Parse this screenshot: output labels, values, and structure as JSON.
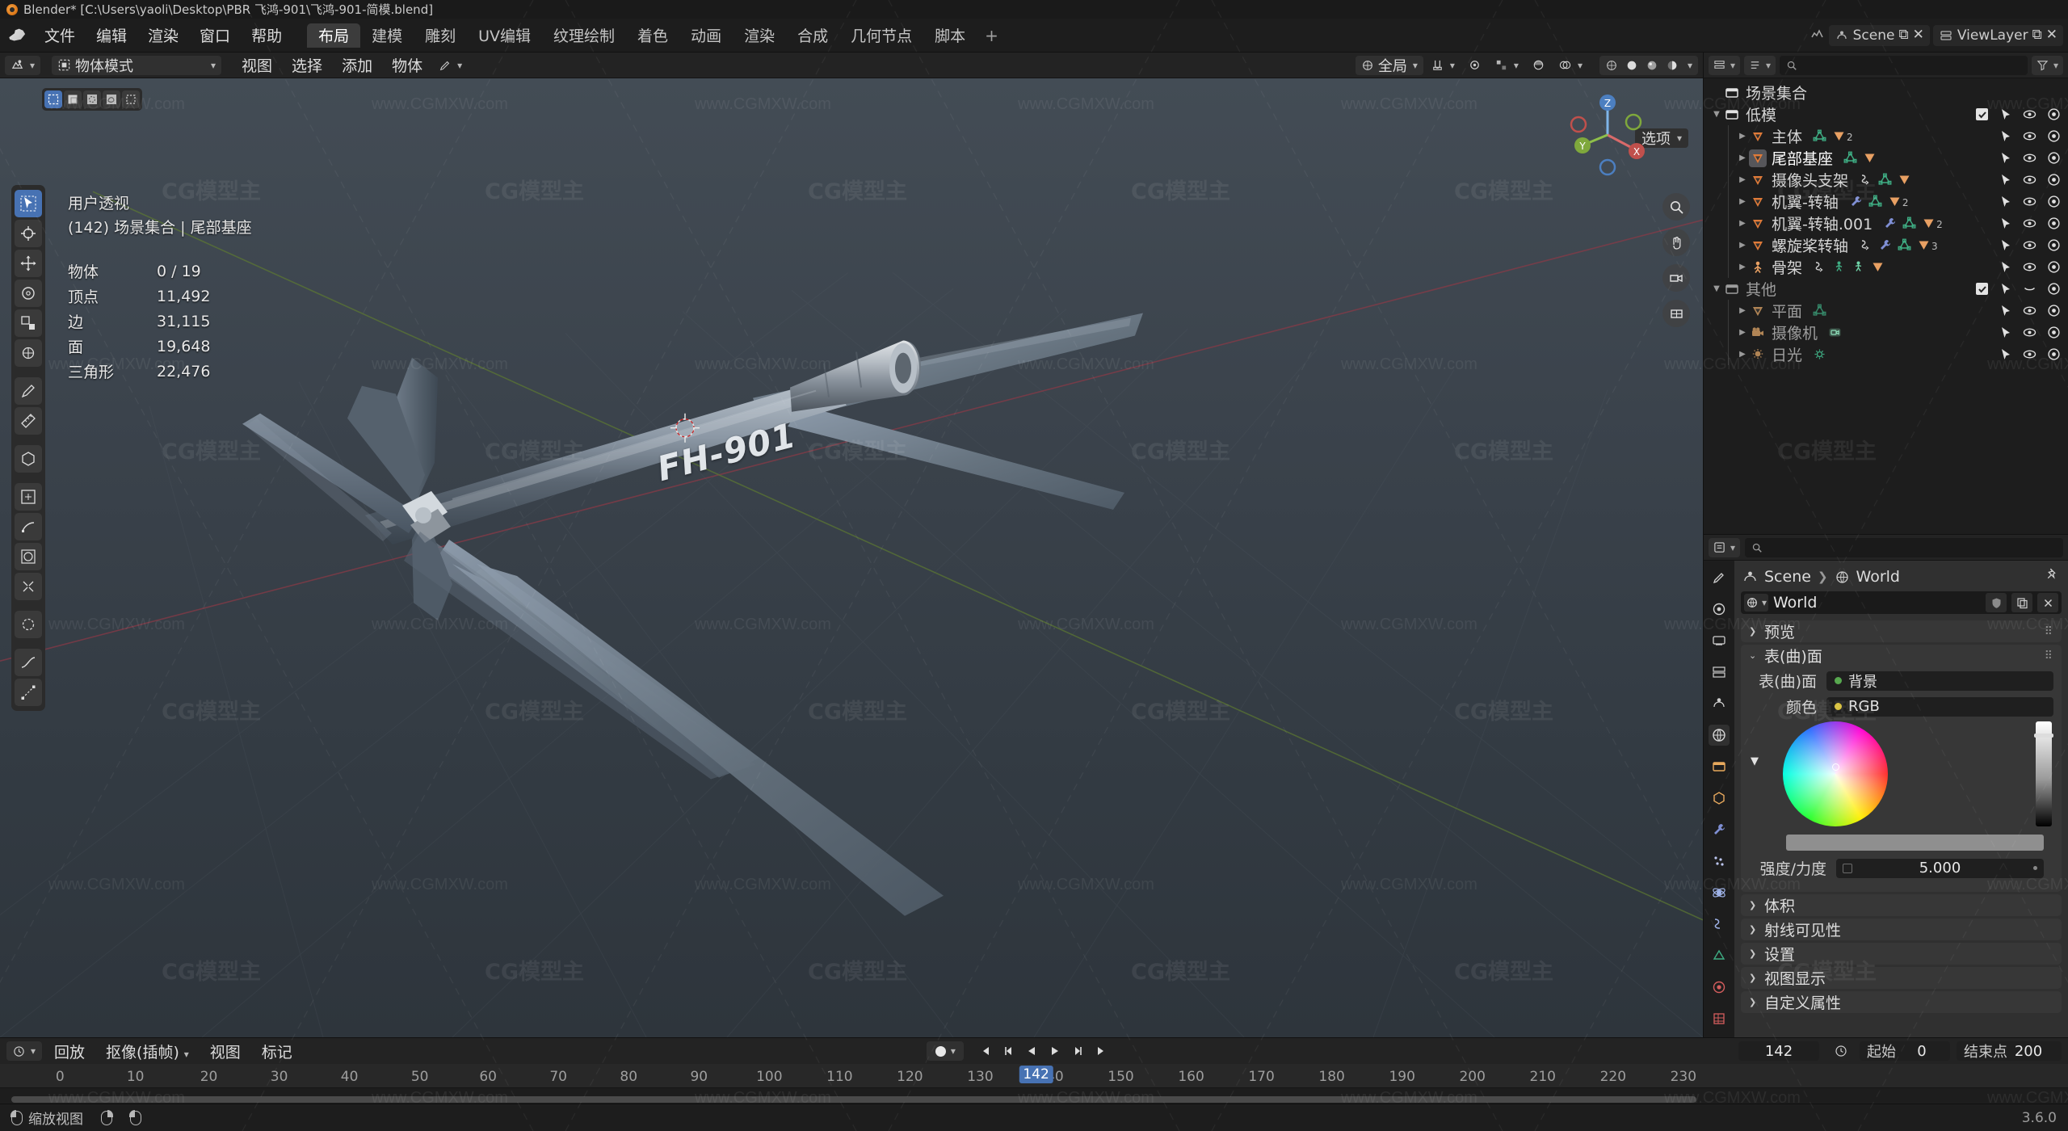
{
  "titlebar": {
    "text": "Blender* [C:\\Users\\yaoli\\Desktop\\PBR 飞鸿-901\\飞鸿-901-简模.blend]"
  },
  "topbar": {
    "menus": [
      "文件",
      "编辑",
      "渲染",
      "窗口",
      "帮助"
    ],
    "workspaces": [
      "布局",
      "建模",
      "雕刻",
      "UV编辑",
      "纹理绘制",
      "着色",
      "动画",
      "渲染",
      "合成",
      "几何节点",
      "脚本"
    ],
    "active_workspace": "布局",
    "add_tab": "+",
    "scene_name": "Scene",
    "viewlayer_name": "ViewLayer"
  },
  "viewport": {
    "header": {
      "mode": "物体模式",
      "menus": [
        "视图",
        "选择",
        "添加",
        "物体"
      ],
      "transform_orientation": "全局",
      "options_label": "选项"
    },
    "overlay": {
      "view_name": "用户透视",
      "collection_line": "(142) 场景集合 | 尾部基座",
      "stats": [
        {
          "label": "物体",
          "value": "0 / 19"
        },
        {
          "label": "顶点",
          "value": "11,492"
        },
        {
          "label": "边",
          "value": "31,115"
        },
        {
          "label": "面",
          "value": "19,648"
        },
        {
          "label": "三角形",
          "value": "22,476"
        }
      ]
    },
    "gizmo_axes": [
      "X",
      "Y",
      "Z"
    ],
    "model_text": "FH-901"
  },
  "outliner": {
    "header": {
      "search_placeholder": "",
      "filter_label": ""
    },
    "root": "场景集合",
    "items": [
      {
        "indent": 0,
        "type": "collection",
        "label": "低模",
        "expanded": true,
        "badges": [],
        "checkbox": true
      },
      {
        "indent": 1,
        "type": "mesh",
        "label": "主体",
        "badges": [
          "mesh-data",
          "material"
        ],
        "material_count": "2"
      },
      {
        "indent": 1,
        "type": "mesh",
        "label": "尾部基座",
        "selected": true,
        "badges": [
          "mesh-data",
          "material"
        ],
        "material_count": ""
      },
      {
        "indent": 1,
        "type": "mesh",
        "label": "摄像头支架",
        "badges": [
          "modifier-arrow",
          "mesh-data",
          "material"
        ],
        "material_count": ""
      },
      {
        "indent": 1,
        "type": "mesh",
        "label": "机翼-转轴",
        "badges": [
          "wrench",
          "mesh-data",
          "material"
        ],
        "material_count": "2"
      },
      {
        "indent": 1,
        "type": "mesh",
        "label": "机翼-转轴.001",
        "badges": [
          "wrench",
          "mesh-data",
          "material"
        ],
        "material_count": "2"
      },
      {
        "indent": 1,
        "type": "mesh",
        "label": "螺旋桨转轴",
        "badges": [
          "modifier-arrow",
          "wrench",
          "mesh-data",
          "material"
        ],
        "material_count": "3"
      },
      {
        "indent": 1,
        "type": "armature",
        "label": "骨架",
        "badges": [
          "modifier-arrow",
          "pose",
          "pose2",
          "material"
        ],
        "material_count": ""
      },
      {
        "indent": 0,
        "type": "collection",
        "label": "其他",
        "expanded": true,
        "checkbox": true,
        "hidden_eye": true
      },
      {
        "indent": 1,
        "type": "mesh",
        "label": "平面",
        "badges": [
          "mesh-data"
        ],
        "material_count": ""
      },
      {
        "indent": 1,
        "type": "camera",
        "label": "摄像机",
        "badges": [
          "camera-data"
        ],
        "material_count": ""
      },
      {
        "indent": 1,
        "type": "light",
        "label": "日光",
        "badges": [
          "light-data"
        ],
        "material_count": ""
      }
    ]
  },
  "properties": {
    "breadcrumb": [
      "Scene",
      "World"
    ],
    "id_name": "World",
    "panels": [
      {
        "label": "预览",
        "open": false
      },
      {
        "label": "表(曲)面",
        "open": true
      },
      {
        "label": "体积",
        "open": false
      },
      {
        "label": "射线可见性",
        "open": false
      },
      {
        "label": "设置",
        "open": false
      },
      {
        "label": "视图显示",
        "open": false
      },
      {
        "label": "自定义属性",
        "open": false
      }
    ],
    "surface": {
      "surface_label": "表(曲)面",
      "surface_value": "背景",
      "surface_dot_color": "#57a84f",
      "color_label": "颜色",
      "color_value": "RGB",
      "color_dot_color": "#d8c03a",
      "strength_label": "强度/力度",
      "strength_value": "5.000"
    }
  },
  "timeline": {
    "editor_label": "回放",
    "keying_label": "抠像(插帧)",
    "menus": [
      "视图",
      "标记"
    ],
    "current_frame": "142",
    "start_label": "起始",
    "start_value": "0",
    "end_label": "结束点",
    "end_value": "200",
    "ruler_ticks": [
      "0",
      "10",
      "20",
      "30",
      "40",
      "50",
      "60",
      "70",
      "80",
      "90",
      "100",
      "110",
      "120",
      "130",
      "140",
      "150",
      "160",
      "170",
      "180",
      "190",
      "200",
      "210",
      "220",
      "230"
    ],
    "playhead_label": "142"
  },
  "status": {
    "left_hint": "缩放视图",
    "version": "3.6.0"
  },
  "colors": {
    "accent_blue": "#4772b3",
    "header_bg": "#232323",
    "panel_bg": "#303030",
    "mesh_orange": "#e07b39",
    "data_green": "#3fae84"
  }
}
